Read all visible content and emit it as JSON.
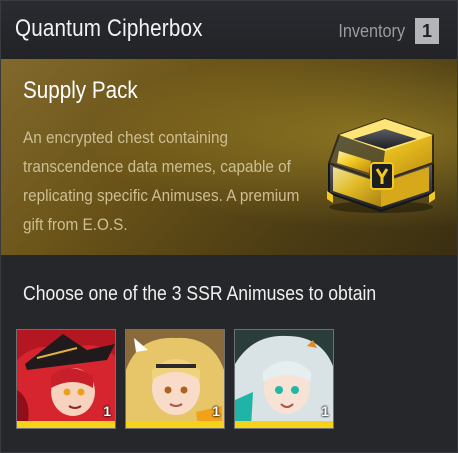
{
  "header": {
    "title": "Quantum Cipherbox",
    "inventory_label": "Inventory",
    "inventory_count": "1"
  },
  "item": {
    "name": "Supply Pack",
    "description": "An encrypted chest containing transcendence data memes, capable of replicating specific Animuses. A premium gift from E.O.S.",
    "icon": "golden-chest-icon"
  },
  "choice": {
    "prompt": "Choose one of the 3 SSR Animuses to obtain",
    "options": [
      {
        "name": "animus-red-hair-witch",
        "quantity": "1",
        "portrait_color": "#c8202a"
      },
      {
        "name": "animus-blonde",
        "quantity": "1",
        "portrait_color": "#e7c66a"
      },
      {
        "name": "animus-silver-hair",
        "quantity": "1",
        "portrait_color": "#2fb8b0"
      }
    ]
  },
  "colors": {
    "accent_yellow": "#f6d21a",
    "panel_bg": "#26272b",
    "banner_gold": "#6b5418"
  }
}
